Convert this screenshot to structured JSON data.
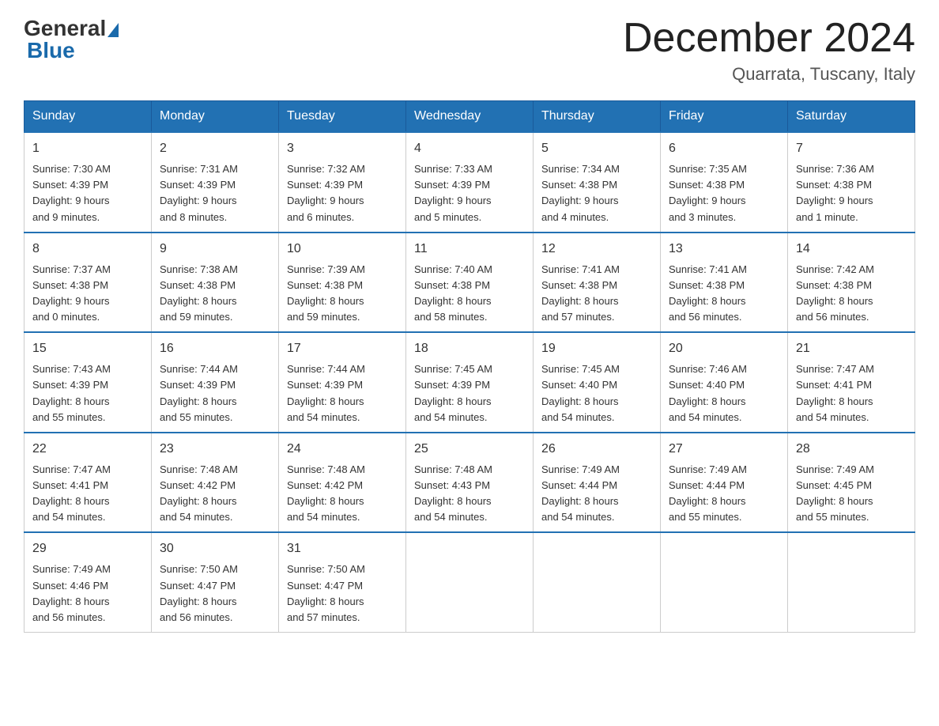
{
  "header": {
    "logo_general": "General",
    "logo_blue": "Blue",
    "month_title": "December 2024",
    "location": "Quarrata, Tuscany, Italy"
  },
  "days_of_week": [
    "Sunday",
    "Monday",
    "Tuesday",
    "Wednesday",
    "Thursday",
    "Friday",
    "Saturday"
  ],
  "weeks": [
    [
      {
        "day": "1",
        "info": "Sunrise: 7:30 AM\nSunset: 4:39 PM\nDaylight: 9 hours\nand 9 minutes."
      },
      {
        "day": "2",
        "info": "Sunrise: 7:31 AM\nSunset: 4:39 PM\nDaylight: 9 hours\nand 8 minutes."
      },
      {
        "day": "3",
        "info": "Sunrise: 7:32 AM\nSunset: 4:39 PM\nDaylight: 9 hours\nand 6 minutes."
      },
      {
        "day": "4",
        "info": "Sunrise: 7:33 AM\nSunset: 4:39 PM\nDaylight: 9 hours\nand 5 minutes."
      },
      {
        "day": "5",
        "info": "Sunrise: 7:34 AM\nSunset: 4:38 PM\nDaylight: 9 hours\nand 4 minutes."
      },
      {
        "day": "6",
        "info": "Sunrise: 7:35 AM\nSunset: 4:38 PM\nDaylight: 9 hours\nand 3 minutes."
      },
      {
        "day": "7",
        "info": "Sunrise: 7:36 AM\nSunset: 4:38 PM\nDaylight: 9 hours\nand 1 minute."
      }
    ],
    [
      {
        "day": "8",
        "info": "Sunrise: 7:37 AM\nSunset: 4:38 PM\nDaylight: 9 hours\nand 0 minutes."
      },
      {
        "day": "9",
        "info": "Sunrise: 7:38 AM\nSunset: 4:38 PM\nDaylight: 8 hours\nand 59 minutes."
      },
      {
        "day": "10",
        "info": "Sunrise: 7:39 AM\nSunset: 4:38 PM\nDaylight: 8 hours\nand 59 minutes."
      },
      {
        "day": "11",
        "info": "Sunrise: 7:40 AM\nSunset: 4:38 PM\nDaylight: 8 hours\nand 58 minutes."
      },
      {
        "day": "12",
        "info": "Sunrise: 7:41 AM\nSunset: 4:38 PM\nDaylight: 8 hours\nand 57 minutes."
      },
      {
        "day": "13",
        "info": "Sunrise: 7:41 AM\nSunset: 4:38 PM\nDaylight: 8 hours\nand 56 minutes."
      },
      {
        "day": "14",
        "info": "Sunrise: 7:42 AM\nSunset: 4:38 PM\nDaylight: 8 hours\nand 56 minutes."
      }
    ],
    [
      {
        "day": "15",
        "info": "Sunrise: 7:43 AM\nSunset: 4:39 PM\nDaylight: 8 hours\nand 55 minutes."
      },
      {
        "day": "16",
        "info": "Sunrise: 7:44 AM\nSunset: 4:39 PM\nDaylight: 8 hours\nand 55 minutes."
      },
      {
        "day": "17",
        "info": "Sunrise: 7:44 AM\nSunset: 4:39 PM\nDaylight: 8 hours\nand 54 minutes."
      },
      {
        "day": "18",
        "info": "Sunrise: 7:45 AM\nSunset: 4:39 PM\nDaylight: 8 hours\nand 54 minutes."
      },
      {
        "day": "19",
        "info": "Sunrise: 7:45 AM\nSunset: 4:40 PM\nDaylight: 8 hours\nand 54 minutes."
      },
      {
        "day": "20",
        "info": "Sunrise: 7:46 AM\nSunset: 4:40 PM\nDaylight: 8 hours\nand 54 minutes."
      },
      {
        "day": "21",
        "info": "Sunrise: 7:47 AM\nSunset: 4:41 PM\nDaylight: 8 hours\nand 54 minutes."
      }
    ],
    [
      {
        "day": "22",
        "info": "Sunrise: 7:47 AM\nSunset: 4:41 PM\nDaylight: 8 hours\nand 54 minutes."
      },
      {
        "day": "23",
        "info": "Sunrise: 7:48 AM\nSunset: 4:42 PM\nDaylight: 8 hours\nand 54 minutes."
      },
      {
        "day": "24",
        "info": "Sunrise: 7:48 AM\nSunset: 4:42 PM\nDaylight: 8 hours\nand 54 minutes."
      },
      {
        "day": "25",
        "info": "Sunrise: 7:48 AM\nSunset: 4:43 PM\nDaylight: 8 hours\nand 54 minutes."
      },
      {
        "day": "26",
        "info": "Sunrise: 7:49 AM\nSunset: 4:44 PM\nDaylight: 8 hours\nand 54 minutes."
      },
      {
        "day": "27",
        "info": "Sunrise: 7:49 AM\nSunset: 4:44 PM\nDaylight: 8 hours\nand 55 minutes."
      },
      {
        "day": "28",
        "info": "Sunrise: 7:49 AM\nSunset: 4:45 PM\nDaylight: 8 hours\nand 55 minutes."
      }
    ],
    [
      {
        "day": "29",
        "info": "Sunrise: 7:49 AM\nSunset: 4:46 PM\nDaylight: 8 hours\nand 56 minutes."
      },
      {
        "day": "30",
        "info": "Sunrise: 7:50 AM\nSunset: 4:47 PM\nDaylight: 8 hours\nand 56 minutes."
      },
      {
        "day": "31",
        "info": "Sunrise: 7:50 AM\nSunset: 4:47 PM\nDaylight: 8 hours\nand 57 minutes."
      },
      null,
      null,
      null,
      null
    ]
  ]
}
